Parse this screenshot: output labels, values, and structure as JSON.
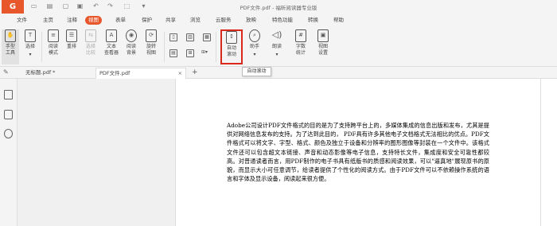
{
  "app": {
    "logo_glyph": "G",
    "window_title": "PDF文件.pdf - 福昕阅读器专业版",
    "accent_color": "#e8562c",
    "highlight_color": "#d9281e"
  },
  "quick_access": {
    "icons": [
      "save-icon",
      "print-icon",
      "open-icon",
      "undo-icon",
      "redo-icon",
      "select-icon",
      "dropdown-icon"
    ]
  },
  "menu": {
    "items": [
      "文件",
      "主页",
      "注释",
      "视图",
      "表单",
      "保护",
      "共享",
      "浏览",
      "云服务",
      "放映",
      "特色功能",
      "转换",
      "帮助"
    ],
    "active": "视图"
  },
  "ribbon": {
    "hand_tool": "手型\n工具",
    "select": "选择",
    "reading_mode": "阅读\n模式",
    "reflow": "重排",
    "select_compare": "选择\n比较",
    "text_viewer": "文本\n查看器",
    "reading_background": "阅读\n背景",
    "rotate_view": "旋转\n视图",
    "auto_scroll": "自动\n滚动",
    "assistant": "助手",
    "read_aloud": "朗读",
    "word_count": "字数\n统计",
    "view_settings": "视图\n设置"
  },
  "tooltip": {
    "text": "自动滚动"
  },
  "tabs": [
    {
      "label": "无标题.pdf *",
      "close": ""
    },
    {
      "label": "PDF文件.pdf",
      "close": "×"
    }
  ],
  "add_tab": "+",
  "document": {
    "paragraph": "Adobe公司设计PDF文件格式的目的是为了支持跨平台上的，多媒体集成的信息出版和发布，尤其是提供对网络信息发布的支持。为了达到此目的， PDF具有许多其他电子文档格式无法相比的优点。PDF文件格式可以将文字、字型、格式、颜色及独立于设备和分辨率的图形图像等封装在一个文件中。该格式文件还可以包含超文本链接、声音和动态影像等电子信息，支持特长文件，集成度和安全可靠性都较高。对普通读者而言，用PDF制作的电子书具有纸版书的质感和阅读效果，可以\"逼真地\"展现原书的原貌，而显示大小可任意调节，给读者提供了个性化的阅读方式。由于PDF文件可以不依赖操作系统的语言和字体及显示设备，阅读起来很方便。"
  }
}
